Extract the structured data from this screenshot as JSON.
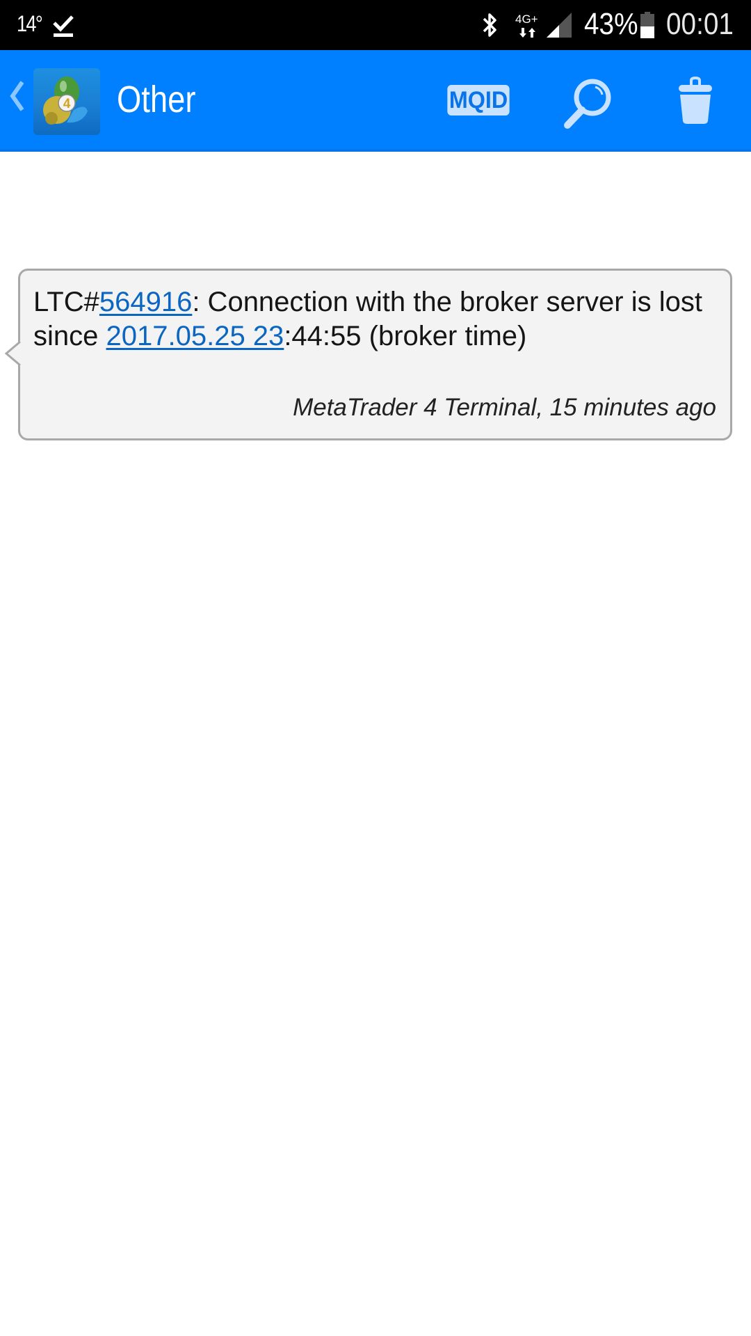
{
  "status_bar": {
    "temperature": "14°",
    "notification_icon": "download-done-icon",
    "icons": [
      "bluetooth-icon",
      "network-4g-plus-icon",
      "signal-icon",
      "battery-icon"
    ],
    "network_label": "4G+",
    "battery_percent": "43%",
    "time": "00:01"
  },
  "app_bar": {
    "back_icon": "chevron-left-icon",
    "app_logo": "metatrader-4-logo",
    "logo_number": "4",
    "title": "Other",
    "mqid_label": "MQID",
    "search_icon": "search-icon",
    "delete_icon": "trash-icon",
    "background_color": "#0080ff"
  },
  "messages": [
    {
      "parts": [
        {
          "text": "LTC#",
          "link": false
        },
        {
          "text": "564916",
          "link": true
        },
        {
          "text": ": Connection with the broker server is lost since ",
          "link": false
        },
        {
          "text": "2017.05.25 23",
          "link": true
        },
        {
          "text": ":44:55 (broker time)",
          "link": false
        }
      ],
      "sender": "MetaTrader 4 Terminal",
      "age": "15 minutes ago",
      "meta": "MetaTrader 4 Terminal, 15 minutes ago",
      "link_color": "#0a66c0",
      "bubble_color": "#f3f3f3"
    }
  ]
}
